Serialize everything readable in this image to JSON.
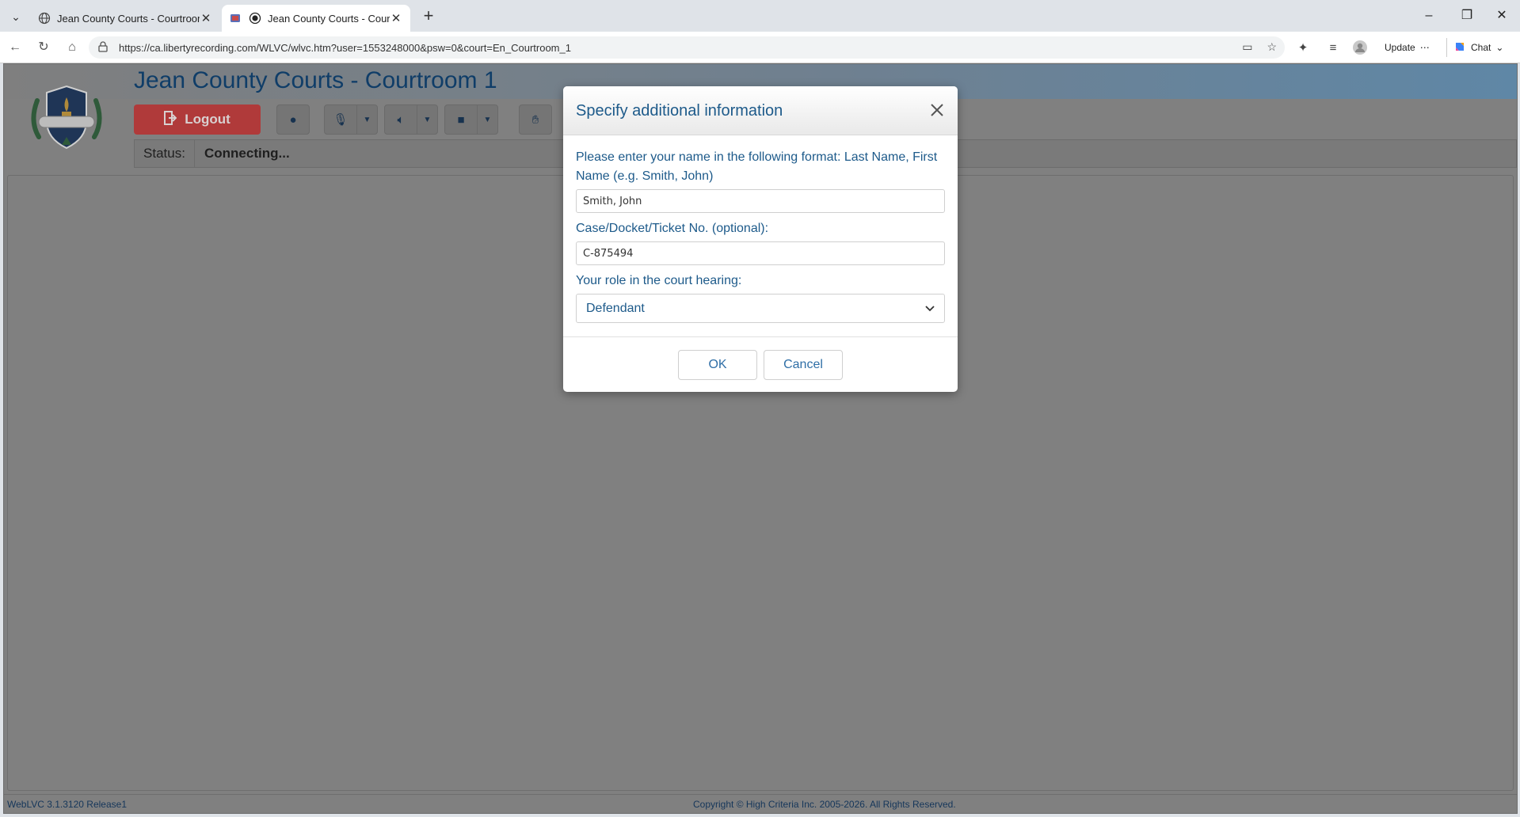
{
  "browser": {
    "tabs": [
      {
        "title": "Jean County Courts - Courtroom 1"
      },
      {
        "title": "Jean County Courts - Courtroom 1"
      }
    ],
    "url": "https://ca.libertyrecording.com/WLVC/wlvc.htm?user=1553248000&psw=0&court=En_Courtroom_1",
    "update_label": "Update",
    "chat_label": "Chat"
  },
  "app": {
    "court_title": "Jean County Courts - Courtroom 1",
    "logout_label": "Logout",
    "status_label": "Status:",
    "status_value": "Connecting...",
    "version": "WebLVC 3.1.3120 Release1",
    "copyright": "Copyright © High Criteria Inc. 2005-2026. All Rights Reserved."
  },
  "modal": {
    "title": "Specify additional information",
    "name_label": "Please enter your name in the following format: Last Name, First Name (e.g. Smith, John)",
    "name_value": "Smith, John",
    "case_label": "Case/Docket/Ticket No. (optional):",
    "case_value": "C-875494",
    "role_label": "Your role in the court hearing:",
    "role_value": "Defendant",
    "ok_label": "OK",
    "cancel_label": "Cancel"
  },
  "colors": {
    "title_blue": "#0f3d68",
    "modal_blue": "#1d5a8a",
    "logout_red": "#b03a3a",
    "overlay_gray": "#808080"
  }
}
